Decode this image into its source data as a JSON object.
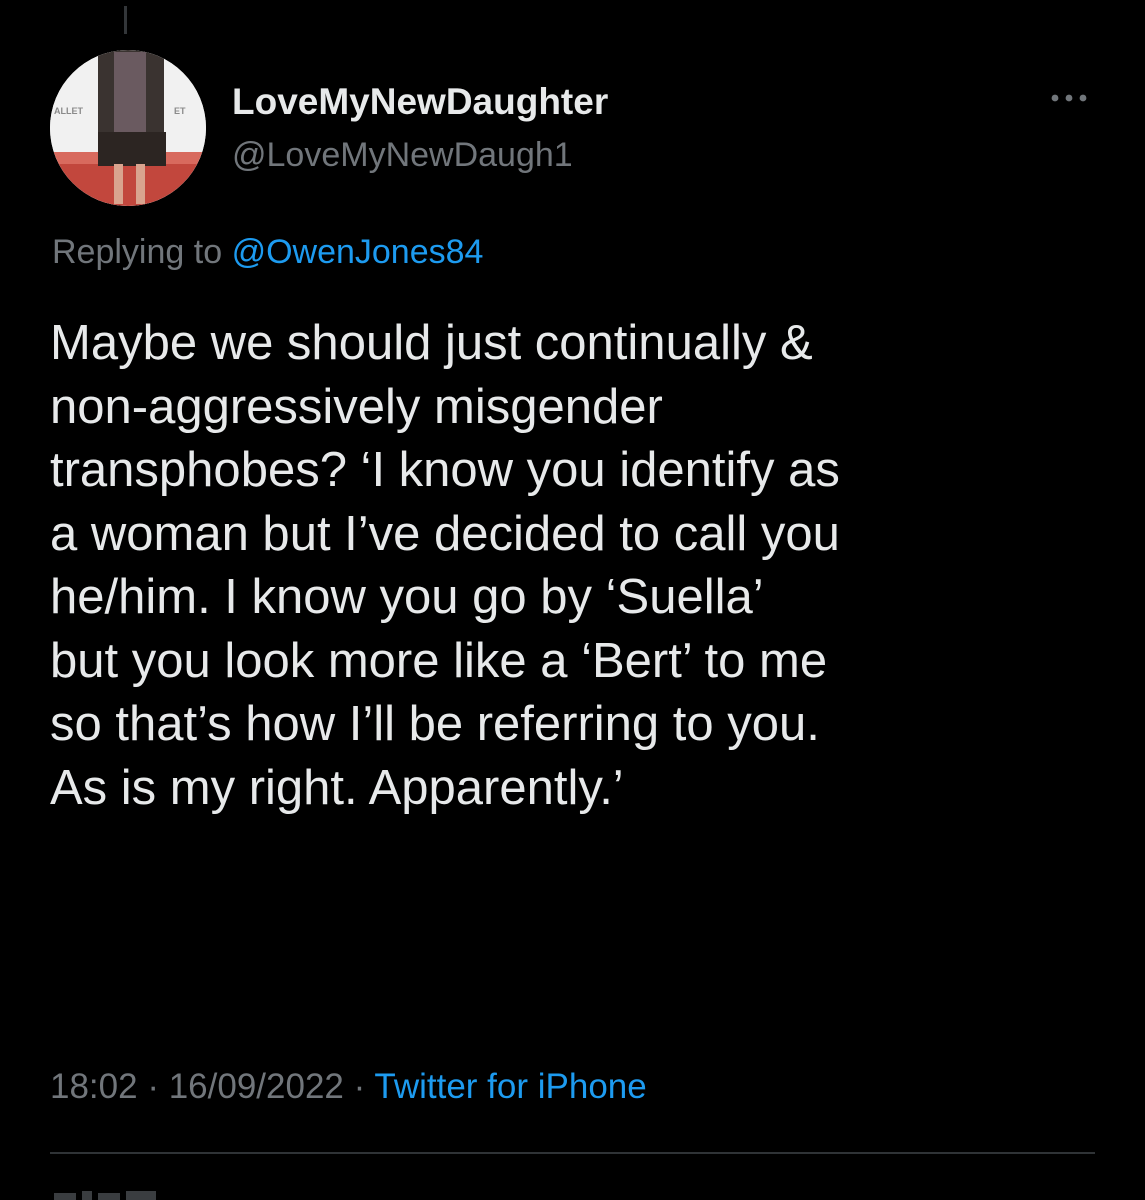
{
  "author": {
    "display_name": "LoveMyNewDaughter",
    "handle": "@LoveMyNewDaugh1"
  },
  "reply_context": {
    "prefix": "Replying to",
    "mention": "@OwenJones84"
  },
  "tweet": {
    "lines": [
      "Maybe we should just continually &",
      "non-aggressively misgender",
      "transphobes? ‘I know you identify as",
      "a woman but I’ve decided to call you",
      "he/him. I know you go by ‘Suella’",
      "but you look more like a ‘Bert’ to me",
      "so that’s how I’ll be referring to you.",
      "As is my right. Apparently.’"
    ]
  },
  "meta": {
    "time": "18:02",
    "separator": "·",
    "date": "16/09/2022",
    "source": "Twitter for iPhone"
  },
  "icons": {
    "more": "more-horizontal-icon",
    "avatar": "profile-photo"
  },
  "colors": {
    "background": "#000000",
    "primary_text": "#e7e9ea",
    "secondary_text": "#71767b",
    "link": "#1d9bf0",
    "divider": "#2f3336"
  }
}
